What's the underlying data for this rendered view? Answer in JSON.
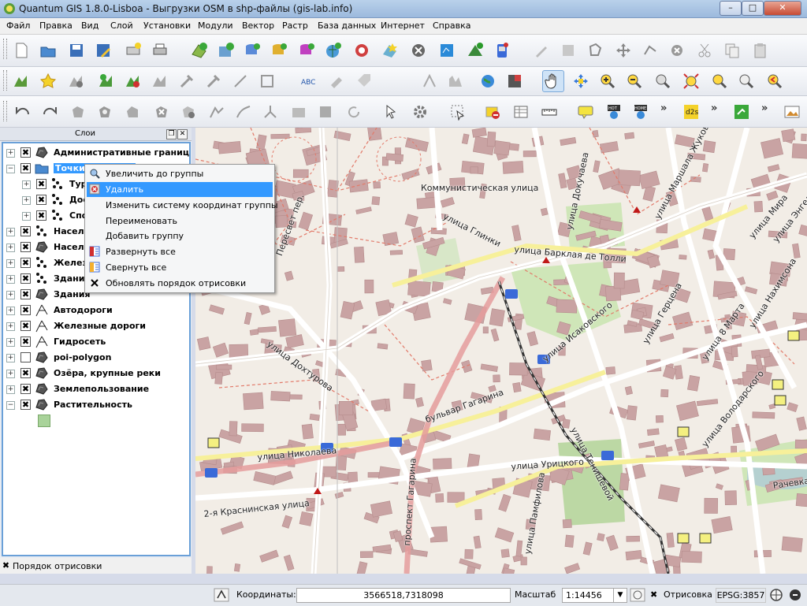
{
  "window": {
    "title": "Quantum GIS 1.8.0-Lisboa - Выгрузки OSM в shp-файлы (gis-lab.info)",
    "minimize": "–",
    "maximize": "□",
    "close": "✕"
  },
  "menu": [
    "Файл",
    "Правка",
    "Вид",
    "Слой",
    "Установки",
    "Модули",
    "Вектор",
    "Растр",
    "База данных",
    "Интернет",
    "Справка"
  ],
  "layers_panel": {
    "title": "Слои",
    "float_btn": "❐",
    "close_btn": "✕",
    "layers": [
      {
        "name": "Административные границы",
        "checked": true,
        "expanded": false,
        "icon": "polygon-icon"
      },
      {
        "name": "Точки интереса",
        "checked": true,
        "expanded": true,
        "icon": "group-icon",
        "selected": true
      },
      {
        "name": "Туризм",
        "checked": true,
        "expanded": false,
        "icon": "points-icon",
        "indent": 1
      },
      {
        "name": "Достопримечательности",
        "checked": true,
        "expanded": false,
        "icon": "points-icon",
        "indent": 1
      },
      {
        "name": "Спорт",
        "checked": true,
        "expanded": false,
        "icon": "points-icon",
        "indent": 1
      },
      {
        "name": "Населённые пункты",
        "checked": true,
        "expanded": false,
        "icon": "points-icon"
      },
      {
        "name": "Населённые пункты (полигоны)",
        "checked": true,
        "expanded": false,
        "icon": "polygon-icon"
      },
      {
        "name": "Железнодорожные станции",
        "checked": true,
        "expanded": false,
        "icon": "points-icon"
      },
      {
        "name": "Здания (точки)",
        "checked": true,
        "expanded": false,
        "icon": "points-icon"
      },
      {
        "name": "Здания",
        "checked": true,
        "expanded": false,
        "icon": "polygon-icon"
      },
      {
        "name": "Автодороги",
        "checked": true,
        "expanded": false,
        "icon": "line-icon"
      },
      {
        "name": "Железные дороги",
        "checked": true,
        "expanded": false,
        "icon": "line-icon"
      },
      {
        "name": "Гидросеть",
        "checked": true,
        "expanded": false,
        "icon": "line-icon"
      },
      {
        "name": "poi-polygon",
        "checked": false,
        "expanded": false,
        "icon": "polygon-icon"
      },
      {
        "name": "Озёра, крупные реки",
        "checked": true,
        "expanded": false,
        "icon": "polygon-icon"
      },
      {
        "name": "Землепользование",
        "checked": true,
        "expanded": false,
        "icon": "polygon-icon"
      },
      {
        "name": "Растительность",
        "checked": true,
        "expanded": true,
        "icon": "polygon-icon"
      }
    ]
  },
  "context_menu": {
    "items": [
      {
        "label": "Увеличить до группы",
        "icon": "zoom-to-icon"
      },
      {
        "label": "Удалить",
        "icon": "remove-icon",
        "highlighted": true
      },
      {
        "label": "Изменить систему координат группы",
        "icon": ""
      },
      {
        "label": "Переименовать",
        "icon": ""
      },
      {
        "label": "Добавить группу",
        "icon": ""
      },
      {
        "label": "Развернуть все",
        "icon": "expand-all-icon"
      },
      {
        "label": "Свернуть все",
        "icon": "collapse-all-icon"
      },
      {
        "label": "Обновлять порядок отрисовки",
        "icon": "checkbox-icon",
        "checked": true
      }
    ]
  },
  "draw_order": {
    "label": "Порядок отрисовки",
    "checked": true
  },
  "map": {
    "streets": [
      "Коммунистическая улица",
      "улица Глинки",
      "улица Докучаева",
      "улица Маршала Жукова",
      "улица Мира",
      "улица Энгельса",
      "улица Нахимсона",
      "улица Барклая де Толли",
      "улица Исаковского",
      "улица Герцена",
      "улица 8 Марта",
      "улица Дохтурова",
      "бульвар Гагарина",
      "улица Володарского",
      "улица Тенишевой",
      "улица Урицкого",
      "улица Николаева",
      "2-я Краснинская улица",
      "проспект Гагарина",
      "улица Памфилова",
      "Рачевка",
      "Пересвет пер."
    ]
  },
  "status": {
    "coord_label": "Координаты:",
    "coord_value": "3566518,7318098",
    "scale_label": "Масштаб",
    "scale_value": "1:14456",
    "render_label": "Отрисовка",
    "render_checked": true,
    "crs": "EPSG:3857"
  },
  "colors": {
    "building": "#c9a3a3",
    "building_stroke": "#b58c8c",
    "road_major": "#f7f09a",
    "road_minor": "#ffffff",
    "rail": "#333333",
    "park": "#cfe6b8",
    "water": "#b5d0d0",
    "dashed_path": "#e27a6a",
    "selection": "#3399ff"
  }
}
